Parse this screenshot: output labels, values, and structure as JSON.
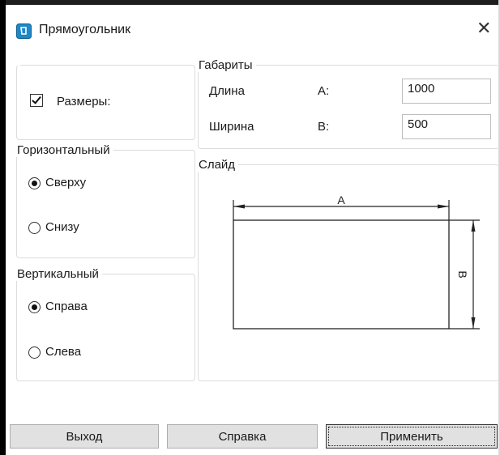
{
  "window": {
    "title": "Прямоугольник",
    "close_glyph": "✕"
  },
  "sizes_group": {
    "checkbox_label": "Размеры:",
    "checked": true
  },
  "horizontal": {
    "legend": "Горизонтальный",
    "options": [
      "Сверху",
      "Снизу"
    ],
    "selected": "Сверху"
  },
  "vertical": {
    "legend": "Вертикальный",
    "options": [
      "Справа",
      "Слева"
    ],
    "selected": "Справа"
  },
  "dimensions": {
    "legend": "Габариты",
    "length": {
      "label": "Длина",
      "key": "A:",
      "value": "1000"
    },
    "width": {
      "label": "Ширина",
      "key": "B:",
      "value": "500"
    }
  },
  "slide": {
    "legend": "Слайд",
    "label_a": "A",
    "label_b": "B"
  },
  "buttons": {
    "exit": "Выход",
    "help": "Справка",
    "apply": "Применить"
  },
  "colors": {
    "accent": "#1e88c7"
  }
}
